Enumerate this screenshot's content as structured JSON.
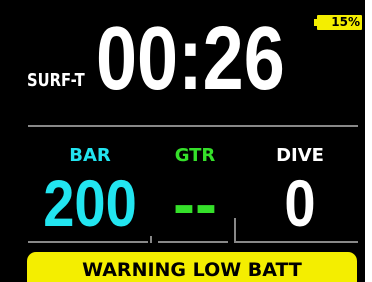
{
  "battery": {
    "percent_text": "15%",
    "level": 0.15,
    "color": "#f4ee00"
  },
  "header": {
    "mode": "SURF-T",
    "time": "00:26"
  },
  "columns": [
    {
      "label": "BAR",
      "value": "200",
      "color": "#22e5f0"
    },
    {
      "label": "GTR",
      "value": "--",
      "color": "#35e02a"
    },
    {
      "label": "DIVE",
      "value": "0",
      "color": "#ffffff"
    }
  ],
  "warning": {
    "text": "WARNING LOW BATT",
    "color": "#f4ee00"
  },
  "colors": {
    "background": "#000000",
    "separator": "#888888"
  }
}
